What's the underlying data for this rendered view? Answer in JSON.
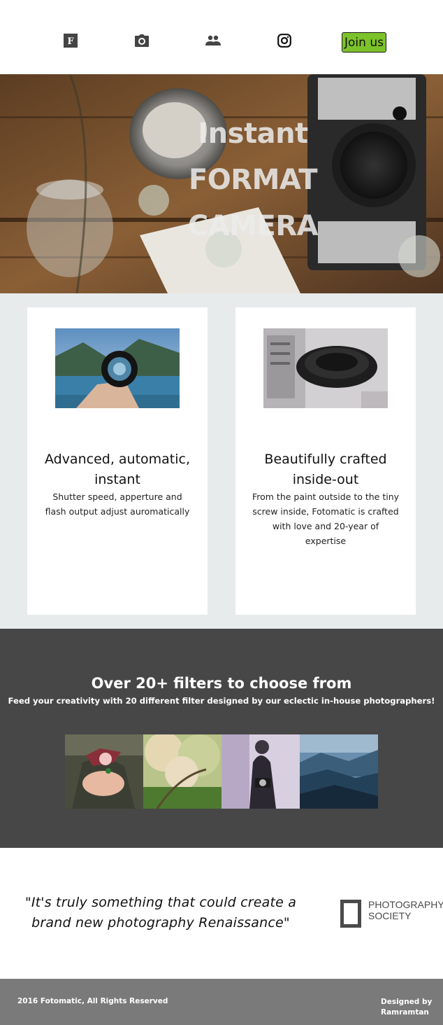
{
  "nav": {
    "items": [
      {
        "name": "fotomatic-logo-icon"
      },
      {
        "name": "camera-icon"
      },
      {
        "name": "people-icon"
      },
      {
        "name": "instagram-icon"
      }
    ],
    "join_label": "Join us",
    "accent_color": "#7cc22a"
  },
  "hero": {
    "title_lines": [
      "Instant",
      "FORMAT",
      "CAMERA"
    ]
  },
  "features": [
    {
      "title": "Advanced, automatic, instant",
      "description": "Shutter speed, apperture and flash output adjust auromatically"
    },
    {
      "title": "Beautifully crafted inside-out",
      "description": "From the paint outside to the tiny screw inside, Fotomatic is crafted with love and 20-year of expertise"
    }
  ],
  "filters": {
    "title": "Over 20+ filters to choose from",
    "subtitle": "Feed your creativity with 20 different filter designed by our eclectic in-house photographers!",
    "background_color": "#474747"
  },
  "testimonial": {
    "quote": "\"It's truly something that could create a brand new photography Renaissance\"",
    "logo_line1": "PHOTOGRAPHY",
    "logo_line2": "SOCIETY"
  },
  "footer": {
    "copyright": "2016 Fotomatic, All Rights Reserved",
    "credit_line1": "Designed by",
    "credit_line2": "Ramramtan",
    "background_color": "#7a7a7a"
  }
}
